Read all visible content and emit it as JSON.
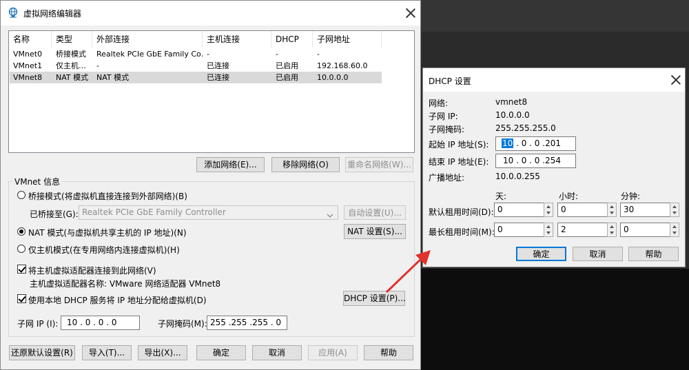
{
  "main": {
    "title": "虚拟网络编辑器",
    "columns": [
      "名称",
      "类型",
      "外部连接",
      "主机连接",
      "DHCP",
      "子网地址"
    ],
    "rows": [
      [
        "VMnet0",
        "桥接模式",
        "Realtek PCIe GbE Family Co…",
        "-",
        "-",
        "-"
      ],
      [
        "VMnet1",
        "仅主机…",
        "-",
        "已连接",
        "已启用",
        "192.168.60.0"
      ],
      [
        "VMnet8",
        "NAT 模式",
        "NAT 模式",
        "已连接",
        "已启用",
        "10.0.0.0"
      ]
    ],
    "add_network": "添加网络(E)...",
    "remove_network": "移除网络(O)",
    "rename_network": "重命名网络(W)...",
    "vmnet_info": "VMnet 信息",
    "bridged_mode": "桥接模式(将虚拟机直接连接到外部网络)(B)",
    "bridged_to_label": "已桥接至(G):",
    "bridged_to_value": "Realtek PCIe GbE Family Controller",
    "auto_settings": "自动设置(U)...",
    "nat_mode": "NAT 模式(与虚拟机共享主机的 IP 地址)(N)",
    "nat_settings": "NAT 设置(S)...",
    "host_only_mode": "仅主机模式(在专用网络内连接虚拟机)(H)",
    "connect_adapter": "将主机虚拟适配器连接到此网络(V)",
    "adapter_name": "主机虚拟适配器名称: VMware 网络适配器 VMnet8",
    "use_dhcp": "使用本地 DHCP 服务将 IP 地址分配给虚拟机(D)",
    "dhcp_settings": "DHCP 设置(P)...",
    "subnet_ip_label": "子网 IP (I):",
    "subnet_ip": "10 . 0 . 0 . 0",
    "subnet_mask_label": "子网掩码(M):",
    "subnet_mask": "255 .255 .255 . 0",
    "restore_defaults": "还原默认设置(R)",
    "import": "导入(T)...",
    "export": "导出(X)...",
    "ok": "确定",
    "cancel": "取消",
    "apply": "应用(A)",
    "help": "帮助"
  },
  "dhcp": {
    "title": "DHCP 设置",
    "network_label": "网络:",
    "network_value": "vmnet8",
    "subnet_ip_label": "子网 IP:",
    "subnet_ip_value": "10.0.0.0",
    "subnet_mask_label": "子网掩码:",
    "subnet_mask_value": "255.255.255.0",
    "start_ip_label": "起始 IP 地址(S):",
    "start_ip_first": "10",
    "start_ip_rest": " .  0  .  0  .201",
    "end_ip_label": "结束 IP 地址(E):",
    "end_ip_value": "10  .  0  .  0  .254",
    "broadcast_label": "广播地址:",
    "broadcast_value": "10.0.0.255",
    "days_label": "天:",
    "hours_label": "小时:",
    "minutes_label": "分钟:",
    "default_lease_label": "默认租用时间(D):",
    "default_days": "0",
    "default_hours": "0",
    "default_minutes": "30",
    "max_lease_label": "最长租用时间(M):",
    "max_days": "0",
    "max_hours": "2",
    "max_minutes": "0",
    "ok": "确定",
    "cancel": "取消",
    "help": "帮助"
  },
  "colors": {
    "annotation_arrow": "#e0322e",
    "selection": "#0078d7"
  }
}
